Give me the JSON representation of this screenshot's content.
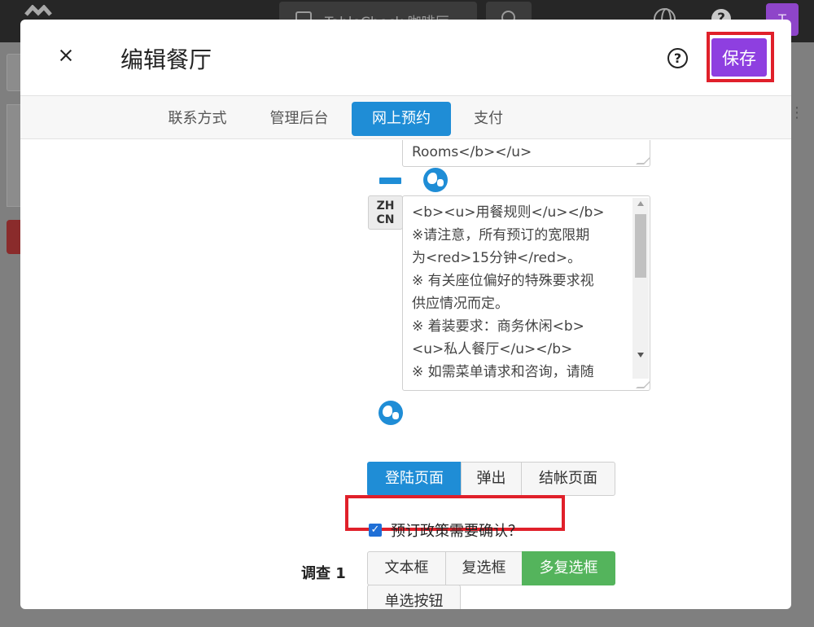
{
  "background": {
    "tab_title": "TableCheck 咖啡厅",
    "help_glyph": "?",
    "avatar_initial": "T",
    "right_glyph": "⋮"
  },
  "modal": {
    "title": "编辑餐厅",
    "help_glyph": "?",
    "save_label": "保存",
    "tabs": [
      "联系方式",
      "管理后台",
      "网上预约",
      "支付"
    ],
    "active_tab": "网上预约"
  },
  "content": {
    "textarea_top_text": "Rooms</b></u>",
    "lang_tag": "ZH\nCN",
    "textarea_lines": [
      "<b><u>用餐规则</u></b>",
      "※请注意，所有预订的宽限期",
      "为<red>15分钟</red>。",
      "※ 有关座位偏好的特殊要求视",
      "供应情况而定。",
      "※ 着装要求：商务休闲<b>",
      "<u>私人餐厅</u></b>",
      "※ 如需菜单请求和咨询，请随"
    ],
    "page_type_buttons": [
      "登陆页面",
      "弹出",
      "结帐页面"
    ],
    "page_type_selected": "登陆页面",
    "confirm_checkbox_label": "预订政策需要确认？",
    "confirm_checked": true,
    "survey_label": "调查 1",
    "survey_type_buttons": [
      "文本框",
      "复选框",
      "多复选框",
      "单选按钮"
    ],
    "survey_type_selected": "多复选框"
  },
  "colors": {
    "accent": "#1f8dd6",
    "save": "#8e3fe0",
    "highlight": "#e0202a",
    "selected_green": "#54b45c"
  }
}
